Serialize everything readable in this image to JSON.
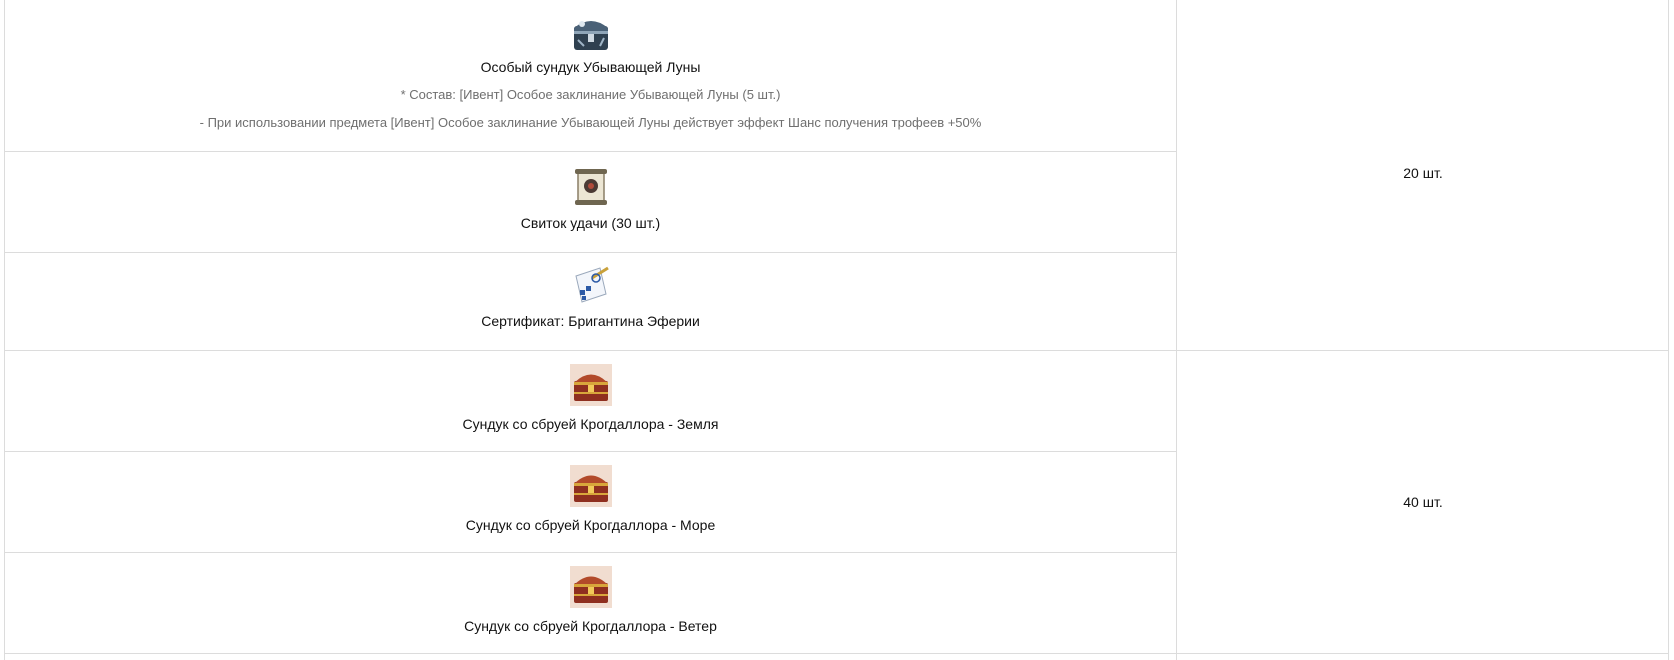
{
  "rows": [
    {
      "icon": "dark-chest-icon",
      "name": "Особый сундук Убывающей Луны",
      "desc1": "* Состав: [Ивент] Особое заклинание Убывающей Луны (5 шт.)",
      "desc2": "- При использовании предмета [Ивент] Особое заклинание Убывающей Луны действует эффект Шанс получения трофеев +50%"
    },
    {
      "icon": "luck-scroll-icon",
      "name": "Свиток удачи (30 шт.)"
    },
    {
      "icon": "certificate-icon",
      "name": "Сертификат: Бригантина Эферии"
    },
    {
      "icon": "treasure-chest-icon",
      "name": "Сундук со сбруей Крогдаллора - Земля"
    },
    {
      "icon": "treasure-chest-icon",
      "name": "Сундук со сбруей Крогдаллора - Море"
    },
    {
      "icon": "treasure-chest-icon",
      "name": "Сундук со сбруей Крогдаллора - Ветер"
    }
  ],
  "quantities": [
    "20 шт.",
    "40 шт."
  ],
  "colors": {
    "border": "#dcdcdc",
    "muted_text": "#6f6f6f",
    "text": "#111111"
  }
}
